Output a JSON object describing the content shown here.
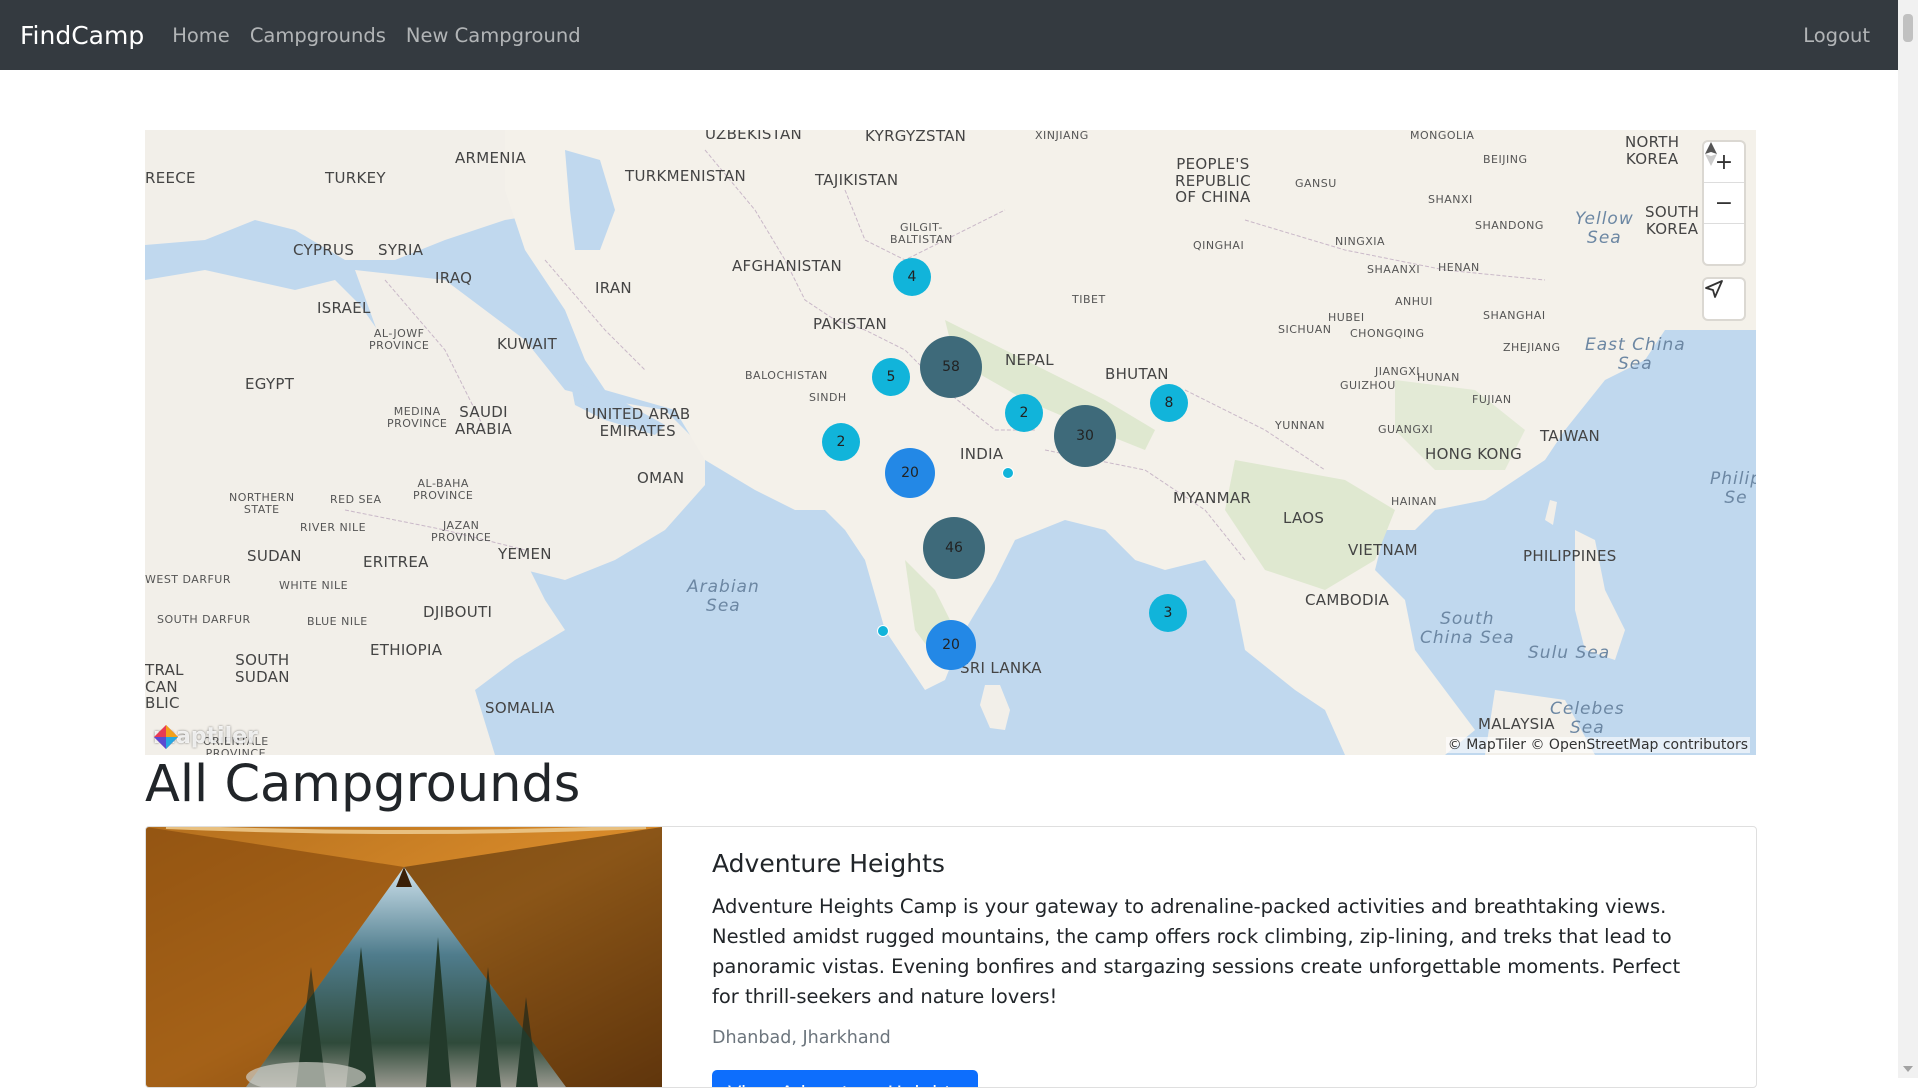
{
  "navbar": {
    "brand": "FindCamp",
    "links": [
      "Home",
      "Campgrounds",
      "New Campground"
    ],
    "logout": "Logout"
  },
  "map": {
    "attribution": "© MapTiler © OpenStreetMap contributors",
    "logo_text": "maptiler",
    "zoom_in_icon": "plus-icon",
    "zoom_out_icon": "minus-icon",
    "compass_icon": "compass-icon",
    "geolocate_icon": "navigation-arrow-icon",
    "clusters": [
      "4",
      "58",
      "5",
      "2",
      "30",
      "2",
      "8",
      "20",
      "46",
      "3",
      "20"
    ],
    "labels": {
      "uzbekistan": "UZBEKISTAN",
      "kyrgyzstan": "KYRGYZSTAN",
      "xinjiang": "XINJIANG",
      "mongolia": "MONGOLIA",
      "north_korea": "NORTH\nKOREA",
      "turkey": "TURKEY",
      "armenia": "ARMENIA",
      "greece": "REECE",
      "turkmenistan": "TURKMENISTAN",
      "tajikistan": "TAJIKISTAN",
      "prc": "PEOPLE'S\nREPUBLIC\nOF CHINA",
      "gansu": "GANSU",
      "shanxi": "SHANXI",
      "beijing": "BEIJING",
      "south_korea": "SOUTH\nKOREA",
      "shandong": "SHANDONG",
      "yellow_sea": "Yellow\nSea",
      "gilgit": "GILGIT-\nBALTISTAN",
      "cyprus": "CYPRUS",
      "syria": "SYRIA",
      "iraq": "IRAQ",
      "iran": "IRAN",
      "afghanistan": "AFGHANISTAN",
      "qinghai": "QINGHAI",
      "ningxia": "NINGXIA",
      "shaanxi": "SHAANXI",
      "henan": "HENAN",
      "israel": "ISRAEL",
      "tibet": "TIBET",
      "anhui": "ANHUI",
      "pakistan": "PAKISTAN",
      "al_jowf": "AL-JOWF\nPROVINCE",
      "kuwait": "KUWAIT",
      "hubei": "HUBEI",
      "shanghai": "SHANGHAI",
      "sichuan": "SICHUAN",
      "chongqing": "CHONGQING",
      "zhejiang": "ZHEJIANG",
      "east_china_sea": "East China\nSea",
      "nepal": "NEPAL",
      "egypt": "EGYPT",
      "balochistan": "BALOCHISTAN",
      "bhutan": "BHUTAN",
      "jiangxi": "JIANGXI",
      "medina": "MEDINA\nPROVINCE",
      "saudi": "SAUDI\nARABIA",
      "uae": "UNITED ARAB\nEMIRATES",
      "sindh": "SINDH",
      "guizhou": "GUIZHOU",
      "hunan": "HUNAN",
      "fujian": "FUJIAN",
      "yunnan": "YUNNAN",
      "guangxi": "GUANGXI",
      "taiwan": "TAIWAN",
      "india": "INDIA",
      "hong_kong": "HONG KONG",
      "oman": "OMAN",
      "al_baha": "AL-BAHA\nPROVINCE",
      "northern_state": "NORTHERN\nSTATE",
      "red_sea": "RED SEA",
      "myanmar": "MYANMAR",
      "philippine_sea": "Philip\nSe",
      "hainan": "HAINAN",
      "river_nile": "RIVER NILE",
      "jazan": "JAZAN\nPROVINCE",
      "laos": "LAOS",
      "sudan": "SUDAN",
      "eritrea": "ERITREA",
      "yemen": "YEMEN",
      "vietnam": "VIETNAM",
      "philippines": "PHILIPPINES",
      "arabian_sea": "Arabian\nSea",
      "west_darfur": "WEST DARFUR",
      "white_nile": "WHITE NILE",
      "cambodia": "CAMBODIA",
      "djibouti": "DJIBOUTI",
      "south_darfur": "SOUTH DARFUR",
      "blue_nile": "BLUE NILE",
      "south_china_sea": "South\nChina Sea",
      "ethiopia": "ETHIOPIA",
      "sulu_sea": "Sulu Sea",
      "tral": "TRAL\nCAN\nBLIC",
      "south_sudan": "SOUTH\nSUDAN",
      "sri_lanka": "SRI LANKA",
      "celebes": "Celebes\nSea",
      "malaysia": "MALAYSIA",
      "somalia": "SOMALIA",
      "orientale": "ORIENTALE\nPROVINCE"
    }
  },
  "page": {
    "title": "All Campgrounds"
  },
  "campground": {
    "title": "Adventure Heights",
    "description": "Adventure Heights Camp is your gateway to adrenaline-packed activities and breathtaking views. Nestled amidst rugged mountains, the camp offers rock climbing, zip-lining, and treks that lead to panoramic vistas. Evening bonfires and stargazing sessions create unforgettable moments. Perfect for thrill-seekers and nature lovers!",
    "location": "Dhanbad, Jharkhand",
    "button": "View Adventure Heights"
  }
}
